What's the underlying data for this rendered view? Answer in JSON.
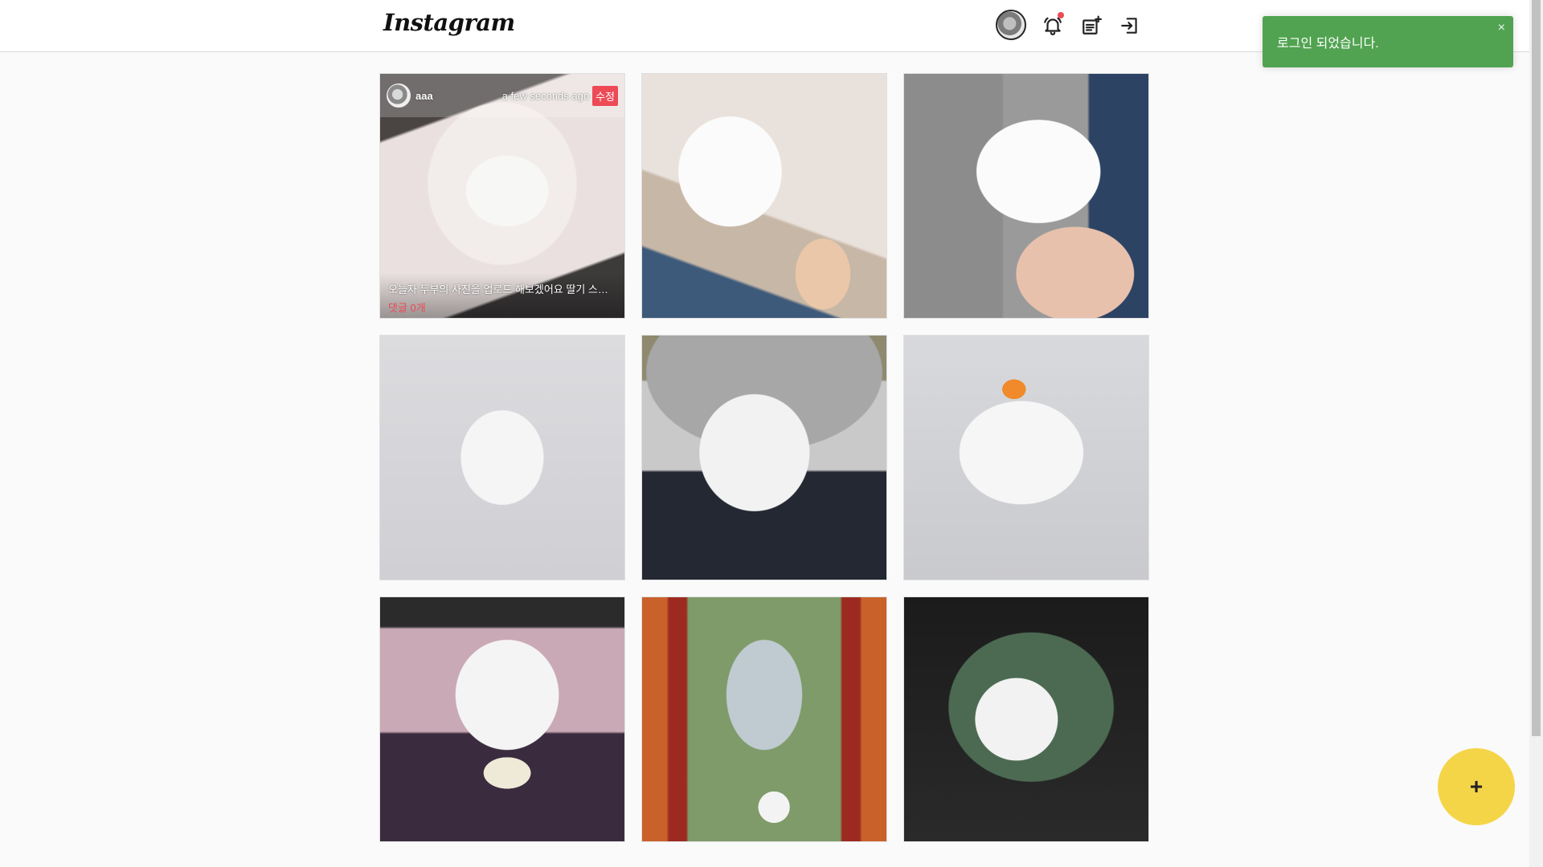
{
  "app": {
    "logo_text": "Instagram"
  },
  "header": {
    "icons": {
      "profile": "avatar",
      "notifications": "bell-icon",
      "new_post": "new-post-icon",
      "logout": "logout-icon"
    },
    "notification_dot_color": "#ed4956"
  },
  "feed": {
    "posts": [
      {
        "username": "aaa",
        "time": "a few seconds ago",
        "edit_label": "수정",
        "caption": "오늘자 두부의 사진을 업로드 해보겠어요 딸기 스카프",
        "comments": "댓글 0개"
      },
      {},
      {},
      {},
      {},
      {},
      {},
      {},
      {}
    ]
  },
  "toast": {
    "message": "로그인 되었습니다.",
    "close_symbol": "×",
    "color": "#51a351"
  },
  "fab": {
    "label": "+",
    "color": "#f4d548"
  }
}
